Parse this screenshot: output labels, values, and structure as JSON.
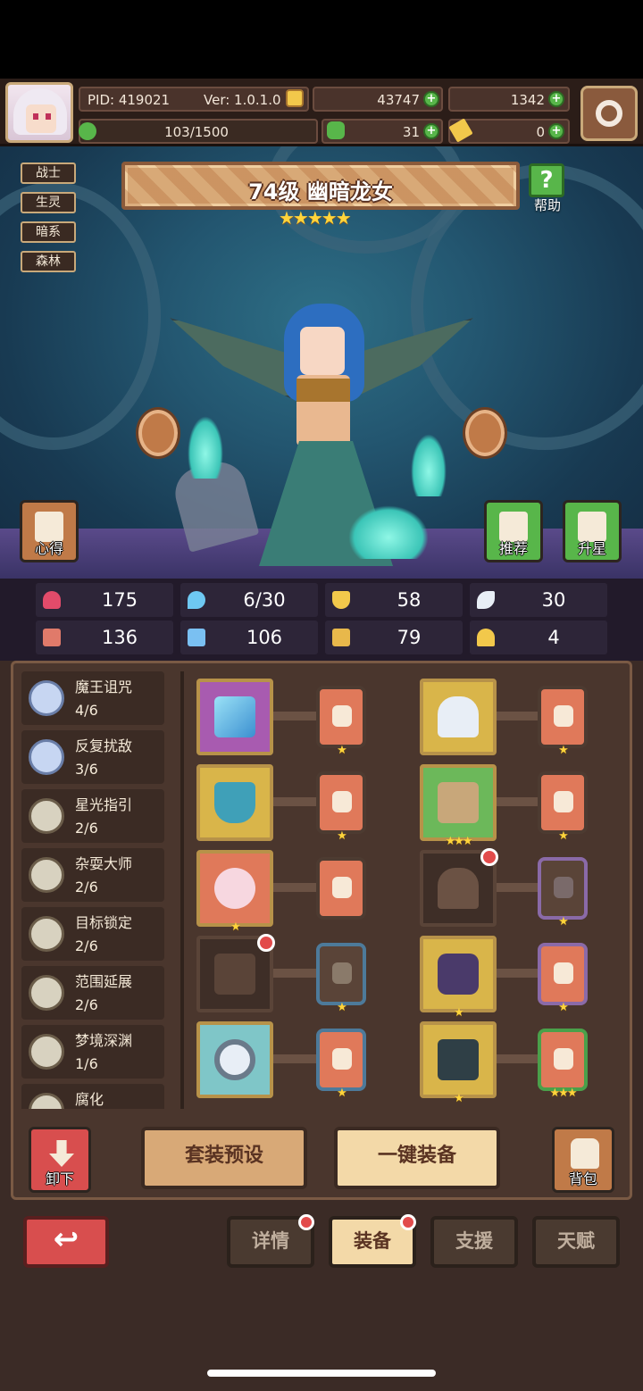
{
  "header": {
    "pid": "PID: 419021",
    "version": "Ver: 1.0.1.0",
    "gold": "43747",
    "gems": "1342",
    "stamina": "103/1500",
    "clover": "31",
    "keys": "0"
  },
  "hero": {
    "tags": [
      "战士",
      "生灵",
      "暗系",
      "森林"
    ],
    "title": "74级  幽暗龙女",
    "stars": "★★★★★",
    "help_label": "帮助",
    "notes_label": "心得",
    "recommend_label": "推荐",
    "starup_label": "升星"
  },
  "stats": [
    {
      "icon": "heart-icon",
      "value": "175",
      "color": "#e24b6a"
    },
    {
      "icon": "water-drop-icon",
      "value": "6/30",
      "color": "#6ec8f2"
    },
    {
      "icon": "shield-icon",
      "value": "58",
      "color": "#f2c84b"
    },
    {
      "icon": "wing-icon",
      "value": "30",
      "color": "#e8eef6"
    },
    {
      "icon": "fist-icon",
      "value": "136",
      "color": "#e07a6a"
    },
    {
      "icon": "book-icon",
      "value": "106",
      "color": "#7ac0f2"
    },
    {
      "icon": "scroll-icon",
      "value": "79",
      "color": "#e8b84b"
    },
    {
      "icon": "horseshoe-icon",
      "value": "4",
      "color": "#f2c84b"
    }
  ],
  "sets": [
    {
      "name": "魔王诅咒",
      "count": "4/6"
    },
    {
      "name": "反复扰敌",
      "count": "3/6"
    },
    {
      "name": "星光指引",
      "count": "2/6"
    },
    {
      "name": "杂耍大师",
      "count": "2/6"
    },
    {
      "name": "目标锁定",
      "count": "2/6"
    },
    {
      "name": "范围延展",
      "count": "2/6"
    },
    {
      "name": "梦境深渊",
      "count": "1/6"
    },
    {
      "name": "腐化",
      "count": ""
    }
  ],
  "equipment": {
    "slot_stars": [
      "",
      "",
      "★★★",
      "",
      "",
      "★",
      "",
      "★",
      "★",
      "★"
    ],
    "gem_stars": [
      "★",
      "★",
      "★",
      "★",
      "",
      "★",
      "★",
      "★",
      "★",
      "★★★"
    ]
  },
  "actions": {
    "unequip_label": "卸下",
    "preset_label": "套装预设",
    "auto_equip_label": "一键装备",
    "bag_label": "背包"
  },
  "tabs": [
    "详情",
    "装备",
    "支援",
    "天赋"
  ],
  "colors": {
    "accent": "#d8a977",
    "panel": "#4a362d",
    "red": "#d84e4e",
    "green": "#58b64a"
  }
}
